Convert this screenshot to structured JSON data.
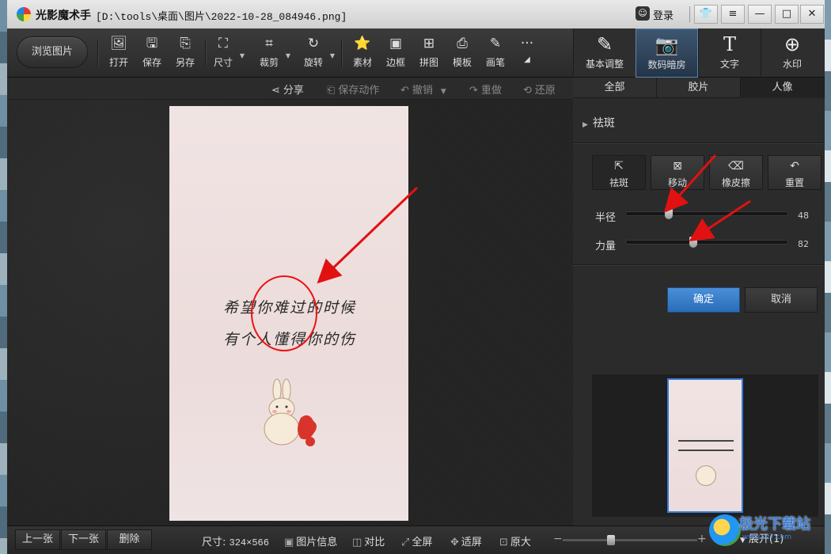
{
  "window": {
    "app_title": "光影魔术手",
    "file_path": "[D:\\tools\\桌面\\图片\\2022-10-28_084946.png]",
    "login_label": "登录",
    "controls": [
      "shirt",
      "menu",
      "minimize",
      "maximize",
      "close"
    ]
  },
  "toolbar": {
    "browse_label": "浏览图片",
    "tools": [
      {
        "label": "打开",
        "icon": "open-icon"
      },
      {
        "label": "保存",
        "icon": "save-icon"
      },
      {
        "label": "另存",
        "icon": "save-as-icon"
      },
      {
        "label": "尺寸",
        "icon": "resize-icon"
      },
      {
        "label": "裁剪",
        "icon": "crop-icon"
      },
      {
        "label": "旋转",
        "icon": "rotate-icon"
      },
      {
        "label": "素材",
        "icon": "material-icon"
      },
      {
        "label": "边框",
        "icon": "border-icon"
      },
      {
        "label": "拼图",
        "icon": "collage-icon"
      },
      {
        "label": "模板",
        "icon": "template-icon"
      },
      {
        "label": "画笔",
        "icon": "brush-icon"
      },
      {
        "label": "···",
        "icon": "more-icon"
      }
    ]
  },
  "right_tabs": [
    {
      "label": "基本调整",
      "icon": "edit-icon"
    },
    {
      "label": "数码暗房",
      "icon": "camera-icon",
      "active": true
    },
    {
      "label": "文字",
      "icon": "text-icon"
    },
    {
      "label": "水印",
      "icon": "watermark-icon"
    }
  ],
  "action_bar": {
    "share": "分享",
    "save_action": "保存动作",
    "undo": "撤销",
    "redo": "重做",
    "restore": "还原"
  },
  "photo": {
    "line1": "希望你难过的时候",
    "line2": "有个人懂得你的伤"
  },
  "right_panel": {
    "subtabs": [
      "全部",
      "胶片",
      "人像"
    ],
    "active_subtab": "人像",
    "section_title": "祛斑",
    "tools": [
      {
        "label": "祛斑",
        "icon": "spot-remove-icon",
        "active": true
      },
      {
        "label": "移动",
        "icon": "move-icon"
      },
      {
        "label": "橡皮擦",
        "icon": "eraser-icon"
      },
      {
        "label": "重置",
        "icon": "reset-icon"
      }
    ],
    "radius": {
      "label": "半径",
      "value": "48",
      "level": 0.25
    },
    "strength": {
      "label": "力量",
      "value": "82",
      "level": 0.41
    },
    "ok_label": "确定",
    "cancel_label": "取消"
  },
  "status_bar": {
    "prev": "上一张",
    "next": "下一张",
    "delete": "删除",
    "size_label": "尺寸:",
    "size_value": "324×566",
    "info": "图片信息",
    "compare": "对比",
    "fullscreen": "全屏",
    "fit": "适屏",
    "original": "原大",
    "expand": "展开(1)",
    "zoom_level": 0.35
  },
  "watermark": {
    "text": "极光下载站",
    "url": "www.xz7.com"
  },
  "colors": {
    "annotation_red": "#e11111",
    "accent_blue": "#3a7bd5"
  }
}
